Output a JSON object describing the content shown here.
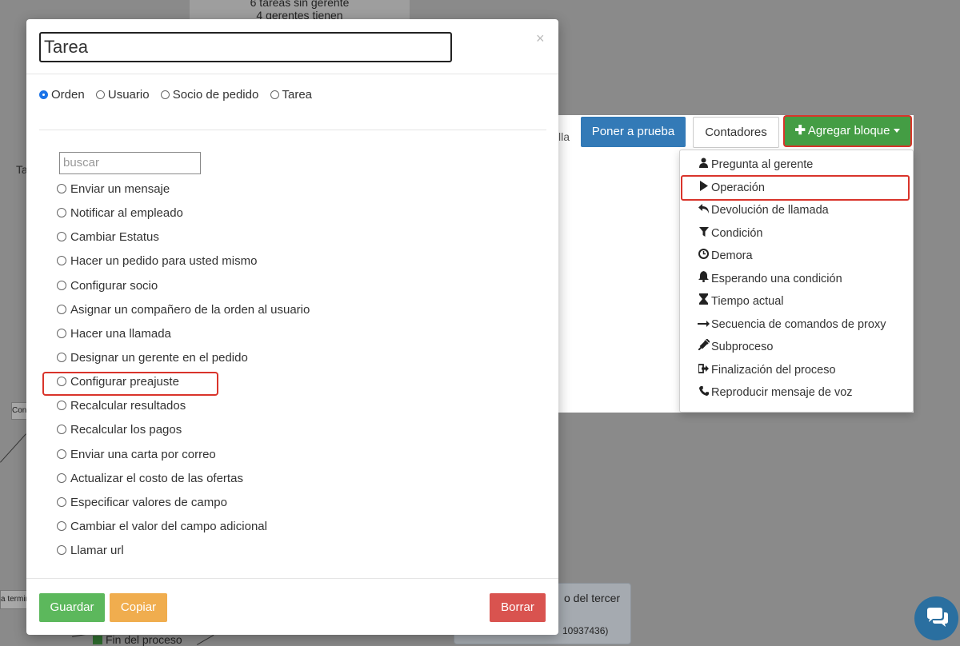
{
  "background": {
    "top_box_lines": [
      "6 tareas sin gerente",
      "4 gerentes tienen"
    ],
    "tab_fragment": "Ta",
    "node_fragment_left": "Con",
    "node_fragment_term": "a termin",
    "node_text": "o del tercer",
    "node_id": "10937436)",
    "end_process": "Fin del proceso"
  },
  "toolbar": {
    "fragment": "lla",
    "test_button": "Poner a prueba",
    "counters_button": "Contadores",
    "add_block_button": "Agregar bloque"
  },
  "dropdown": {
    "items": [
      {
        "label": "Pregunta al gerente",
        "icon": "user-icon"
      },
      {
        "label": "Operación",
        "icon": "play-icon"
      },
      {
        "label": "Devolución de llamada",
        "icon": "reply-icon"
      },
      {
        "label": "Condición",
        "icon": "filter-icon"
      },
      {
        "label": "Demora",
        "icon": "clock-icon"
      },
      {
        "label": "Esperando una condición",
        "icon": "bell-icon"
      },
      {
        "label": "Tiempo actual",
        "icon": "hourglass-icon"
      },
      {
        "label": "Secuencia de comandos de proxy",
        "icon": "arrow-right-icon"
      },
      {
        "label": "Subproceso",
        "icon": "plug-icon"
      },
      {
        "label": "Finalización del proceso",
        "icon": "sign-out-icon"
      },
      {
        "label": "Reproducir mensaje de voz",
        "icon": "phone-icon"
      }
    ],
    "highlighted": "Operación"
  },
  "modal": {
    "title_value": "Tarea",
    "close": "×",
    "types": [
      {
        "label": "Orden",
        "checked": true
      },
      {
        "label": "Usuario",
        "checked": false
      },
      {
        "label": "Socio de pedido",
        "checked": false
      },
      {
        "label": "Tarea",
        "checked": false
      }
    ],
    "search_placeholder": "buscar",
    "operations": [
      "Enviar un mensaje",
      "Notificar al empleado",
      "Cambiar Estatus",
      "Hacer un pedido para usted mismo",
      "Configurar socio",
      "Asignar un compañero de la orden al usuario",
      "Hacer una llamada",
      "Designar un gerente en el pedido",
      "Configurar preajuste",
      "Recalcular resultados",
      "Recalcular los pagos",
      "Enviar una carta por correo",
      "Actualizar el costo de las ofertas",
      "Especificar valores de campo",
      "Cambiar el valor del campo adicional",
      "Llamar url"
    ],
    "highlighted_operation": "Configurar preajuste",
    "save_button": "Guardar",
    "copy_button": "Copiar",
    "delete_button": "Borrar"
  },
  "colors": {
    "primary": "#337ab7",
    "success": "#5cb85c",
    "add_green": "#449d44",
    "warning": "#f0ad4e",
    "danger": "#d9534f",
    "highlight_red": "#d9342b"
  }
}
